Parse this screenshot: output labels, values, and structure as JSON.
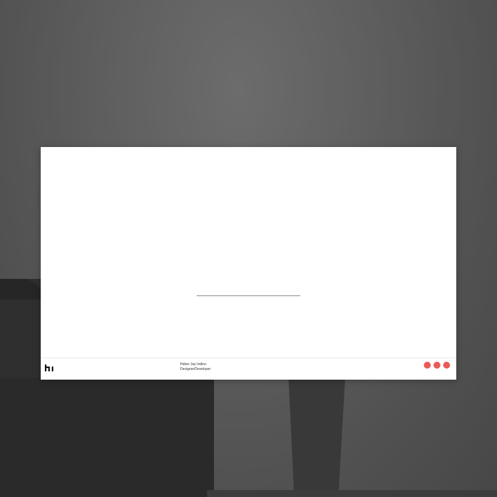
{
  "site": {
    "author_name": "Heber Jay Indino",
    "author_role": "Designer/Developer"
  },
  "loader": {
    "progress": 1.0
  },
  "menu": {
    "dots": [
      {
        "icon": "dot-icon",
        "color": "#e95b57"
      },
      {
        "icon": "dot-icon",
        "color": "#e95b57"
      },
      {
        "icon": "dot-icon",
        "color": "#e95b57"
      }
    ]
  },
  "logo": {
    "icon": "hi-logo-icon"
  }
}
